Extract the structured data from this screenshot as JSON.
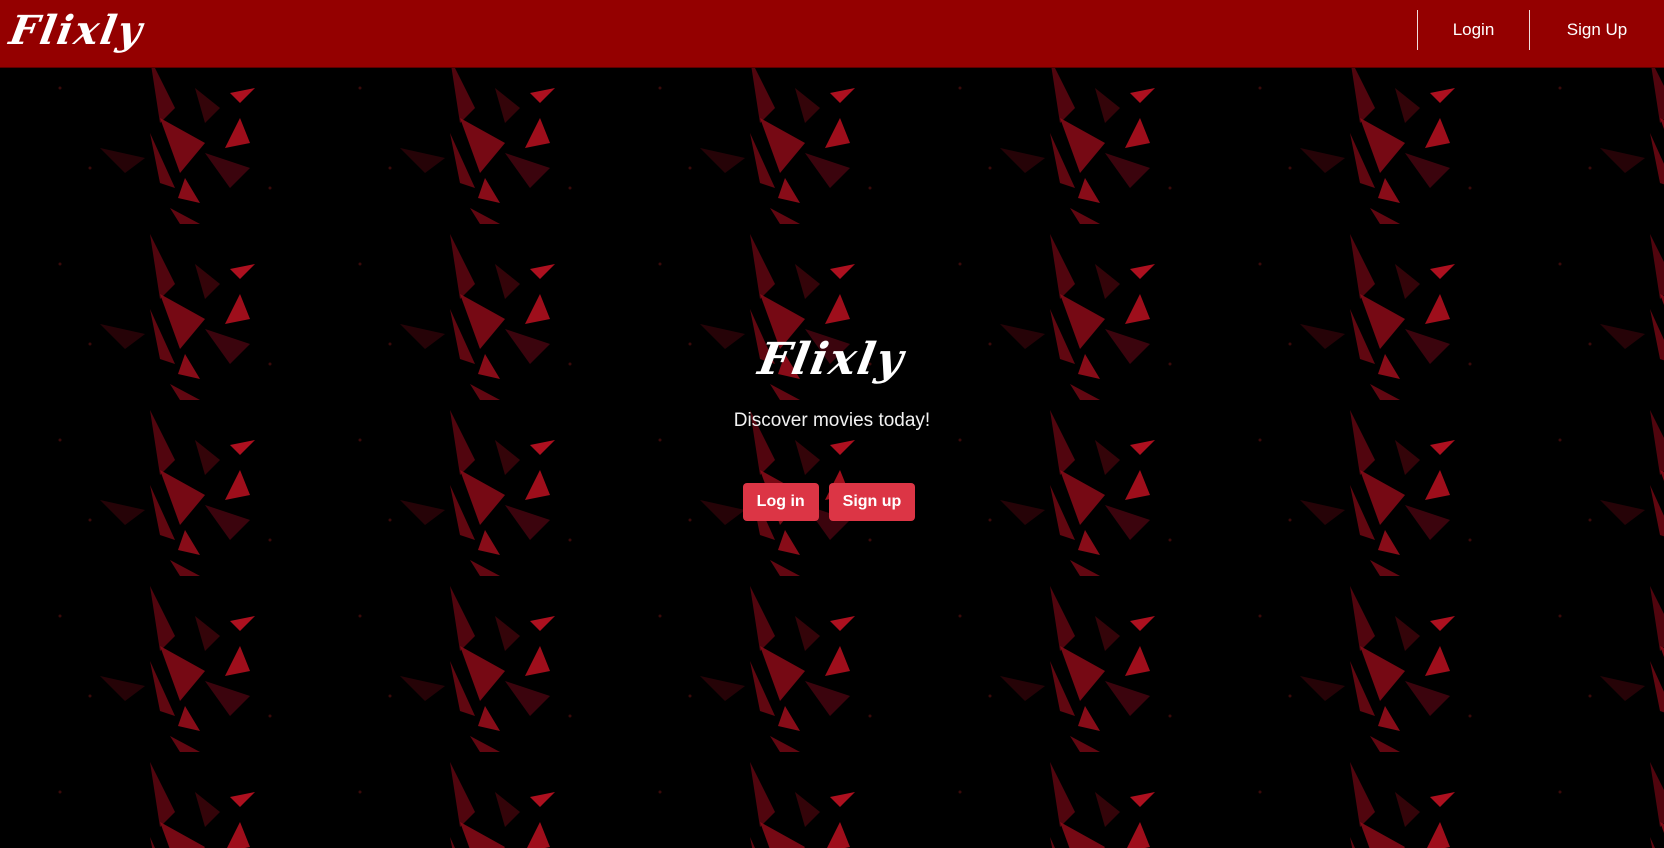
{
  "navbar": {
    "brand": "Flixly",
    "links": [
      {
        "label": "Login"
      },
      {
        "label": "Sign Up"
      }
    ]
  },
  "hero": {
    "logo": "Flixly",
    "tagline": "Discover movies today!",
    "buttons": [
      {
        "label": "Log in"
      },
      {
        "label": "Sign up"
      }
    ]
  },
  "colors": {
    "navbar": "#940000",
    "background": "#000000",
    "accent_button": "#dc3545",
    "pattern": "#8b0a17"
  }
}
